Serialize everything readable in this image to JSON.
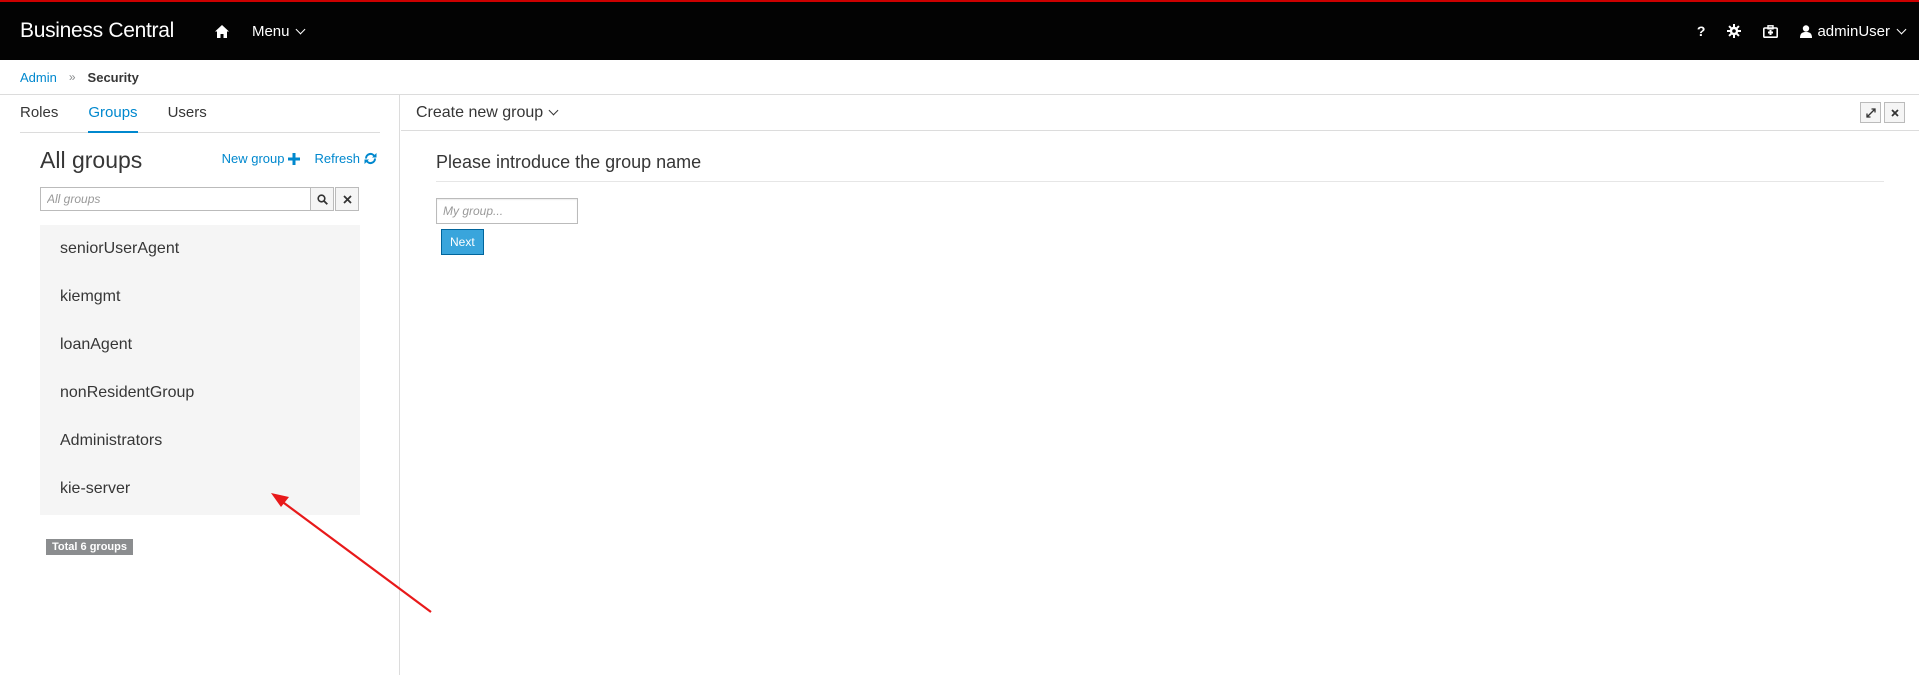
{
  "header": {
    "brand": "Business Central",
    "menu_label": "Menu",
    "user_label": "adminUser",
    "icons": [
      "home-icon",
      "help-icon",
      "gear-icon",
      "briefcase-icon",
      "user-icon"
    ]
  },
  "breadcrumb": {
    "parent": "Admin",
    "separator": "»",
    "current": "Security"
  },
  "tabs": [
    {
      "label": "Roles",
      "active": false
    },
    {
      "label": "Groups",
      "active": true
    },
    {
      "label": "Users",
      "active": false
    }
  ],
  "groups_panel": {
    "title": "All groups",
    "new_group_label": "New group",
    "refresh_label": "Refresh",
    "search_placeholder": "All groups",
    "items": [
      "seniorUserAgent",
      "kiemgmt",
      "loanAgent",
      "nonResidentGroup",
      "Administrators",
      "kie-server"
    ],
    "total_label": "Total 6 groups"
  },
  "editor": {
    "title": "Create new group",
    "form_title": "Please introduce the group name",
    "name_placeholder": "My group...",
    "next_label": "Next"
  },
  "colors": {
    "accent": "#0088ce",
    "topbar": "#030303",
    "topbar_border": "#cc0000",
    "primary_button": "#39a5dc",
    "annotation_arrow": "#e8191a"
  }
}
